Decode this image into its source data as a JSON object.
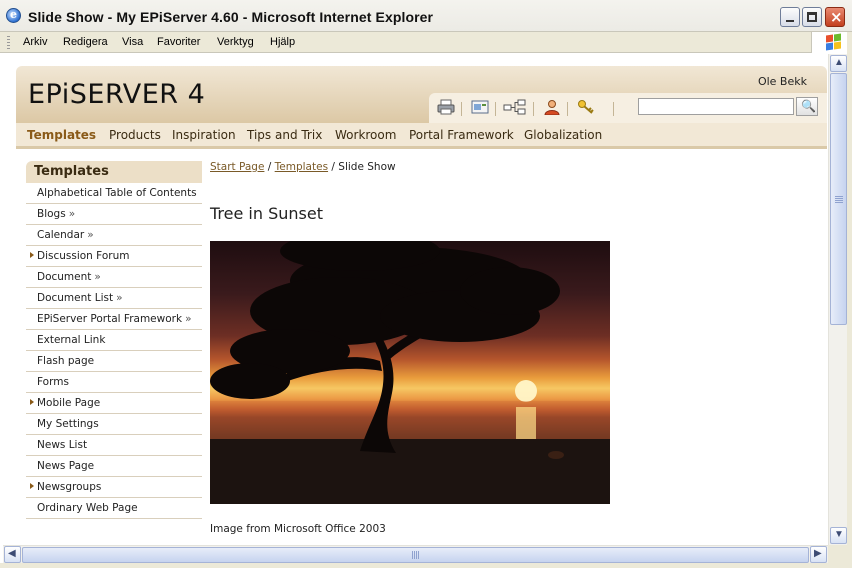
{
  "window": {
    "title": "Slide Show - My EPiServer 4.60 - Microsoft Internet Explorer"
  },
  "menubar": {
    "items": [
      "Arkiv",
      "Redigera",
      "Visa",
      "Favoriter",
      "Verktyg",
      "Hjälp"
    ]
  },
  "site": {
    "logo": "EPiSERVER 4",
    "user": "Ole Bekk",
    "search_value": "",
    "toolbar_icons": [
      "printer-icon",
      "email-icon",
      "sitemap-icon",
      "user-icon",
      "key-icon"
    ],
    "nav": [
      "Templates",
      "Products",
      "Inspiration",
      "Tips and Trix",
      "Workroom",
      "Portal Framework",
      "Globalization"
    ],
    "active_nav": "Templates"
  },
  "leftmenu": {
    "title": "Templates",
    "items": [
      {
        "label": "Alphabetical Table of Contents",
        "has_children": false,
        "has_arrow": false
      },
      {
        "label": "Blogs",
        "has_children": true,
        "has_arrow": false
      },
      {
        "label": "Calendar",
        "has_children": true,
        "has_arrow": false
      },
      {
        "label": "Discussion Forum",
        "has_children": false,
        "has_arrow": true
      },
      {
        "label": "Document",
        "has_children": true,
        "has_arrow": false
      },
      {
        "label": "Document List",
        "has_children": true,
        "has_arrow": false
      },
      {
        "label": "EPiServer Portal Framework",
        "has_children": true,
        "has_arrow": false
      },
      {
        "label": "External Link",
        "has_children": false,
        "has_arrow": false
      },
      {
        "label": "Flash page",
        "has_children": false,
        "has_arrow": false
      },
      {
        "label": "Forms",
        "has_children": false,
        "has_arrow": false
      },
      {
        "label": "Mobile Page",
        "has_children": false,
        "has_arrow": true
      },
      {
        "label": "My Settings",
        "has_children": false,
        "has_arrow": false
      },
      {
        "label": "News List",
        "has_children": false,
        "has_arrow": false
      },
      {
        "label": "News Page",
        "has_children": false,
        "has_arrow": false
      },
      {
        "label": "Newsgroups",
        "has_children": false,
        "has_arrow": true
      },
      {
        "label": "Ordinary Web Page",
        "has_children": false,
        "has_arrow": false
      }
    ]
  },
  "content": {
    "breadcrumb": {
      "start": "Start Page",
      "sep1": "/",
      "templates": "Templates",
      "sep2": "/",
      "current": "Slide Show"
    },
    "title": "Tree in Sunset",
    "image_caption": "Image from Microsoft Office 2003"
  },
  "colors": {
    "header_bg": "#dcc8a5",
    "nav_bg": "#f2e8d6",
    "active_nav": "#8a5a18",
    "link": "#7a5a28"
  }
}
